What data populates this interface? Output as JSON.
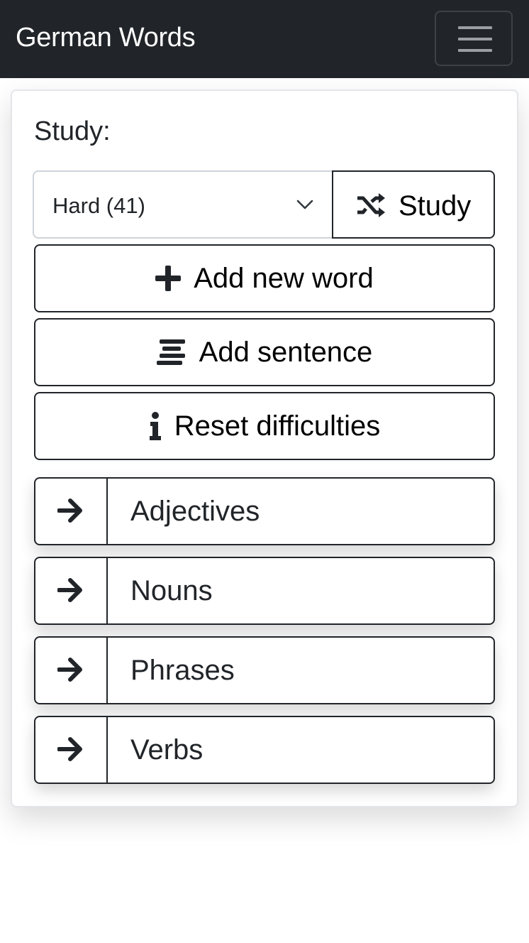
{
  "navbar": {
    "brand": "German Words",
    "toggler_icon": "hamburger-menu-icon"
  },
  "card": {
    "title": "Study:",
    "select": {
      "selected": "Hard (41)",
      "icon": "chevron-down-icon"
    },
    "study_button": {
      "label": "Study",
      "icon": "shuffle-icon"
    },
    "actions": [
      {
        "label": "Add new word",
        "icon": "plus-icon"
      },
      {
        "label": "Add sentence",
        "icon": "align-center-icon"
      },
      {
        "label": "Reset difficulties",
        "icon": "info-icon"
      }
    ],
    "categories": [
      {
        "label": "Adjectives",
        "icon": "arrow-right-icon"
      },
      {
        "label": "Nouns",
        "icon": "arrow-right-icon"
      },
      {
        "label": "Phrases",
        "icon": "arrow-right-icon"
      },
      {
        "label": "Verbs",
        "icon": "arrow-right-icon"
      }
    ]
  },
  "colors": {
    "navbar_bg": "#212529",
    "text": "#212529",
    "border": "#212529"
  }
}
